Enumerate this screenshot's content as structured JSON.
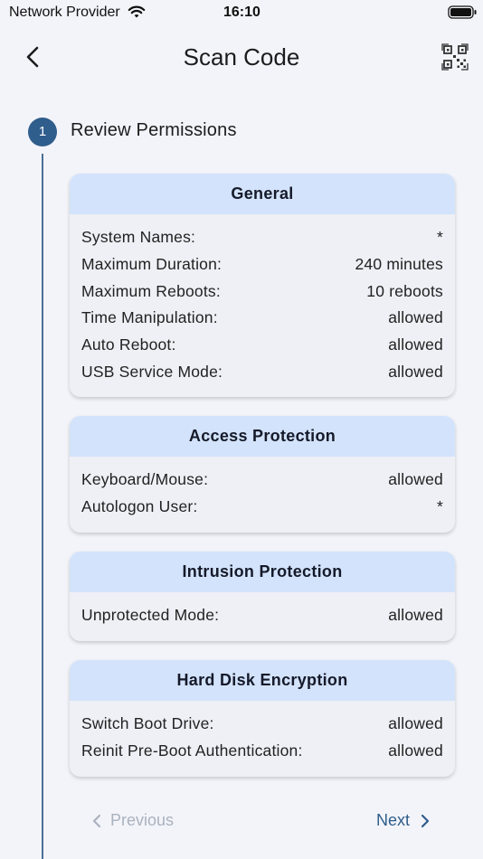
{
  "status_bar": {
    "carrier": "Network Provider",
    "time": "16:10"
  },
  "nav": {
    "title": "Scan Code"
  },
  "step": {
    "number": "1",
    "title": "Review Permissions"
  },
  "cards": [
    {
      "title": "General",
      "rows": [
        {
          "label": "System Names:",
          "value": "*"
        },
        {
          "label": "Maximum Duration:",
          "value": "240 minutes"
        },
        {
          "label": "Maximum Reboots:",
          "value": "10 reboots"
        },
        {
          "label": "Time Manipulation:",
          "value": "allowed"
        },
        {
          "label": "Auto Reboot:",
          "value": "allowed"
        },
        {
          "label": "USB Service Mode:",
          "value": "allowed"
        }
      ]
    },
    {
      "title": "Access Protection",
      "rows": [
        {
          "label": "Keyboard/Mouse:",
          "value": "allowed"
        },
        {
          "label": "Autologon User:",
          "value": "*"
        }
      ]
    },
    {
      "title": "Intrusion Protection",
      "rows": [
        {
          "label": "Unprotected Mode:",
          "value": "allowed"
        }
      ]
    },
    {
      "title": "Hard Disk Encryption",
      "rows": [
        {
          "label": "Switch Boot Drive:",
          "value": "allowed"
        },
        {
          "label": "Reinit Pre-Boot Authentication:",
          "value": "allowed"
        }
      ]
    }
  ],
  "footer": {
    "previous_label": "Previous",
    "next_label": "Next"
  },
  "colors": {
    "accent": "#2f5d8c",
    "card_header": "#d3e3fb",
    "disabled": "#aab2bf"
  }
}
